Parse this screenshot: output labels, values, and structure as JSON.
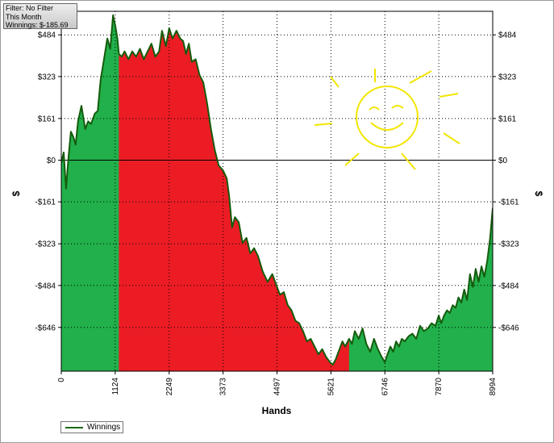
{
  "info": {
    "filter": "Filter: No Filter",
    "period": "This Month",
    "winnings": "Winnings: $-185.69"
  },
  "colors": {
    "positive_fill": "#21b04b",
    "negative_fill": "#ec1c24",
    "line": "#145c0c",
    "zero_line": "#000000",
    "grid": "#000000",
    "doodle": "#f2e600"
  },
  "chart_data": {
    "type": "area",
    "title": "",
    "xlabel": "Hands",
    "ylabel": "$",
    "ylabel_right": "$",
    "xlim": [
      0,
      8994
    ],
    "ylim": [
      -815,
      575
    ],
    "x_ticks": [
      "0",
      "1124",
      "2249",
      "3373",
      "4497",
      "5621",
      "6746",
      "7870",
      "8994"
    ],
    "y_ticks": [
      {
        "value": 484,
        "label": "$484"
      },
      {
        "value": 323,
        "label": "$323"
      },
      {
        "value": 161,
        "label": "$161"
      },
      {
        "value": 0,
        "label": "$0"
      },
      {
        "value": -161,
        "label": "-$161"
      },
      {
        "value": -323,
        "label": "-$323"
      },
      {
        "value": -484,
        "label": "-$484"
      },
      {
        "value": -646,
        "label": "-$646"
      }
    ],
    "grid": true,
    "legend": "bottom-left",
    "red_region_x": [
      1200,
      6000
    ],
    "series": [
      {
        "name": "Winnings",
        "x": [
          0,
          50,
          100,
          150,
          200,
          250,
          300,
          350,
          420,
          500,
          560,
          620,
          700,
          760,
          820,
          900,
          960,
          1020,
          1080,
          1124,
          1170,
          1200,
          1260,
          1320,
          1400,
          1480,
          1560,
          1640,
          1720,
          1800,
          1880,
          1960,
          2040,
          2100,
          2180,
          2249,
          2320,
          2400,
          2480,
          2540,
          2600,
          2660,
          2720,
          2800,
          2880,
          2960,
          3040,
          3120,
          3200,
          3280,
          3373,
          3450,
          3500,
          3560,
          3620,
          3700,
          3780,
          3860,
          3940,
          4020,
          4100,
          4200,
          4300,
          4400,
          4497,
          4560,
          4640,
          4720,
          4800,
          4880,
          4960,
          5040,
          5120,
          5200,
          5280,
          5360,
          5440,
          5520,
          5600,
          5660,
          5720,
          5800,
          5860,
          5920,
          6000,
          6060,
          6120,
          6200,
          6280,
          6360,
          6440,
          6520,
          6600,
          6680,
          6746,
          6800,
          6860,
          6920,
          6980,
          7040,
          7100,
          7160,
          7240,
          7320,
          7400,
          7480,
          7560,
          7640,
          7720,
          7800,
          7870,
          7920,
          7980,
          8040,
          8100,
          8160,
          8220,
          8280,
          8340,
          8400,
          8460,
          8520,
          8580,
          8640,
          8700,
          8760,
          8820,
          8880,
          8940,
          8994
        ],
        "values": [
          -10,
          30,
          -110,
          10,
          110,
          90,
          60,
          150,
          210,
          120,
          150,
          140,
          180,
          190,
          310,
          400,
          470,
          430,
          560,
          520,
          470,
          410,
          400,
          420,
          390,
          420,
          400,
          430,
          390,
          420,
          450,
          400,
          420,
          500,
          440,
          510,
          470,
          500,
          470,
          460,
          410,
          450,
          380,
          390,
          330,
          300,
          220,
          120,
          40,
          -20,
          -40,
          -70,
          -140,
          -260,
          -220,
          -240,
          -320,
          -300,
          -360,
          -340,
          -370,
          -430,
          -470,
          -440,
          -490,
          -520,
          -510,
          -560,
          -580,
          -620,
          -630,
          -660,
          -700,
          -690,
          -720,
          -750,
          -730,
          -760,
          -780,
          -790,
          -770,
          -730,
          -700,
          -720,
          -690,
          -710,
          -660,
          -690,
          -650,
          -710,
          -740,
          -690,
          -730,
          -760,
          -780,
          -750,
          -720,
          -740,
          -700,
          -720,
          -690,
          -700,
          -680,
          -670,
          -690,
          -640,
          -660,
          -650,
          -630,
          -640,
          -600,
          -630,
          -600,
          -580,
          -590,
          -560,
          -570,
          -530,
          -550,
          -500,
          -540,
          -440,
          -490,
          -420,
          -470,
          -410,
          -450,
          -390,
          -300,
          -185
        ]
      }
    ]
  }
}
